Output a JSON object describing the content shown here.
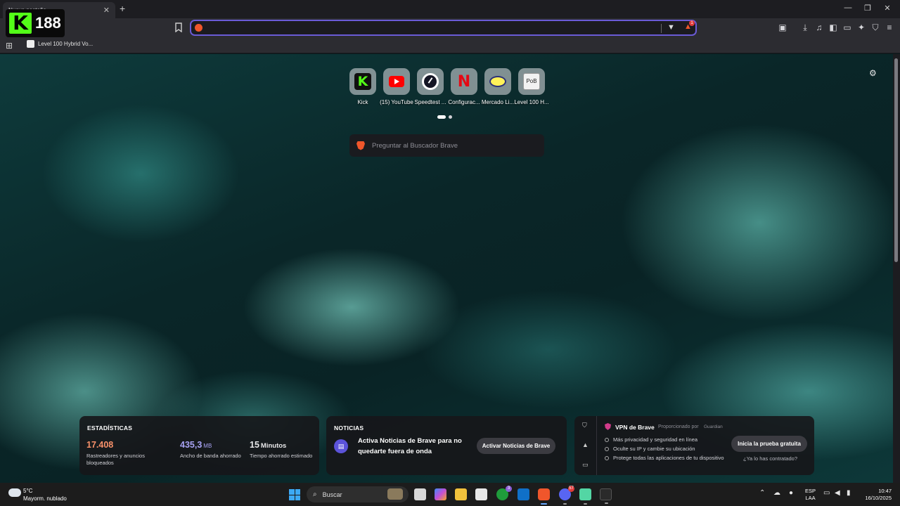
{
  "tab": {
    "title": "Nueva pestaña",
    "close": "✕",
    "new_tab": "+"
  },
  "window_controls": {
    "minimize": "—",
    "maximize": "❐",
    "close": "✕"
  },
  "kick_overlay": {
    "logo": "K",
    "count": "188"
  },
  "address_bar": {
    "value": "",
    "rewards_badge": "1"
  },
  "bookmarks": {
    "items": [
      {
        "label": "Level 100 Hybrid Vo..."
      }
    ]
  },
  "top_sites": [
    {
      "label": "Kick",
      "icon": "kick-icon"
    },
    {
      "label": "(15) YouTube",
      "icon": "youtube-icon"
    },
    {
      "label": "Speedtest ...",
      "icon": "speedtest-icon"
    },
    {
      "label": "Configurac...",
      "icon": "netflix-icon",
      "glyph": "N"
    },
    {
      "label": "Mercado Li...",
      "icon": "mercadolibre-icon"
    },
    {
      "label": "Level 100 H...",
      "icon": "pob-icon",
      "glyph": "PoB"
    }
  ],
  "search": {
    "placeholder": "Preguntar al Buscador Brave"
  },
  "stats": {
    "title": "ESTADÍSTICAS",
    "trackers": {
      "value": "17.408",
      "label": "Rastreadores y anuncios bloqueados",
      "color": "#f8916a"
    },
    "bandwidth": {
      "value": "435,3",
      "unit": "MB",
      "label": "Ancho de banda ahorrado",
      "color": "#a8a3f3"
    },
    "time": {
      "value": "15",
      "unit": "Minutos",
      "label": "Tiempo ahorrado estimado",
      "color": "#ffffff"
    }
  },
  "news": {
    "title": "NOTICIAS",
    "text": "Activa Noticias de Brave para no quedarte fuera de onda",
    "button": "Activar Noticias de Brave"
  },
  "vpn": {
    "title": "VPN de Brave",
    "powered_by": "Proporcionado por",
    "provider": "Guardian",
    "bullets": [
      "Más privacidad y seguridad en línea",
      "Oculte su IP y cambie su ubicación",
      "Protege todas las aplicaciones de tu dispositivo"
    ],
    "button": "Inicia la prueba gratuita",
    "link": "¿Ya lo has contratado?"
  },
  "taskbar": {
    "weather": {
      "temp": "5°C",
      "desc": "Mayorm. nublado"
    },
    "search_label": "Buscar",
    "xbox_badge": "3",
    "discord_badge": "57",
    "language": {
      "line1": "ESP",
      "line2": "LAA"
    },
    "clock": {
      "time": "10:47",
      "date": "16/10/2025"
    }
  }
}
